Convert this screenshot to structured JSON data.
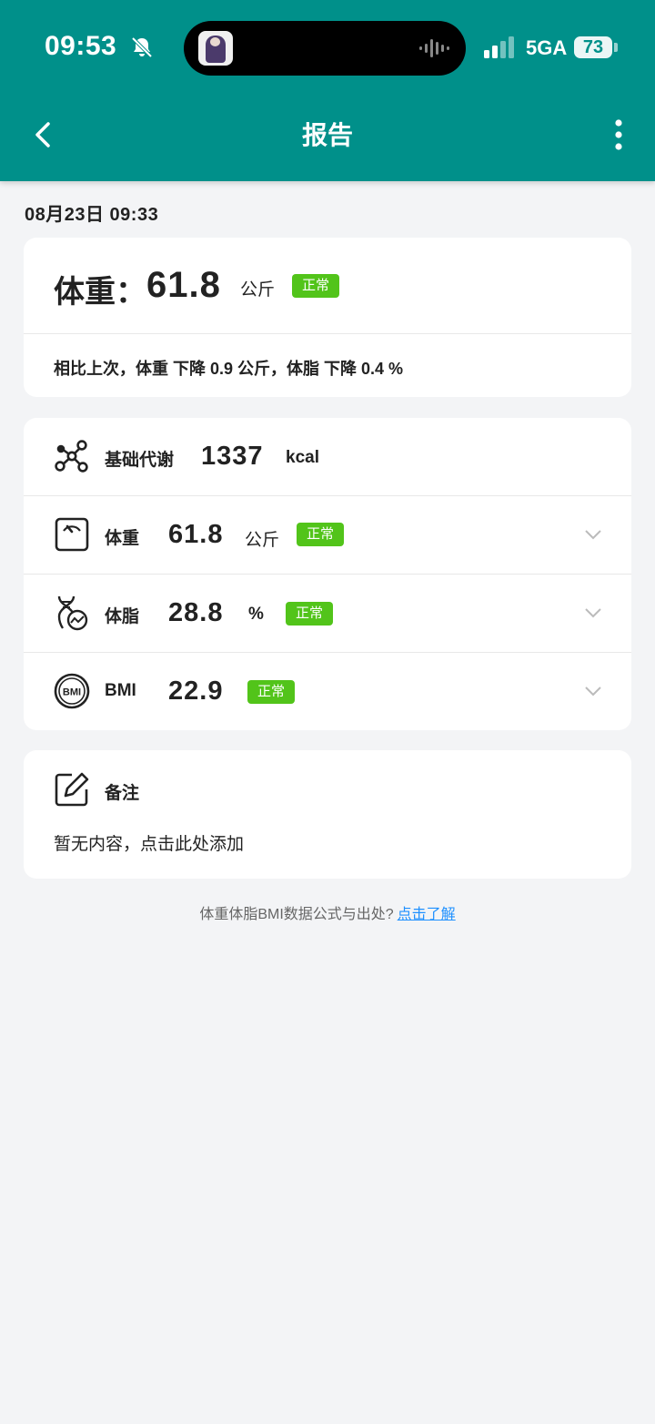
{
  "status_bar": {
    "time": "09:53",
    "network": "5GA",
    "battery": "73",
    "icons": [
      "bell-mute-icon",
      "waveform-icon",
      "signal-icon",
      "battery-icon"
    ]
  },
  "header": {
    "title": "报告",
    "back_icon": "chevron-left-icon",
    "more_icon": "more-vertical-icon"
  },
  "report": {
    "date": "08月23日 09:33",
    "summary": {
      "label": "体重：",
      "value": "61.8",
      "unit": "公斤",
      "status": "正常",
      "comparison": "相比上次，体重 下降 0.9 公斤，体脂 下降 0.4 %"
    },
    "metrics": {
      "bmr": {
        "icon": "molecule-icon",
        "label": "基础代谢",
        "value": "1337",
        "unit": "kcal"
      },
      "weight": {
        "icon": "scale-icon",
        "label": "体重",
        "value": "61.8",
        "unit": "公斤",
        "status": "正常"
      },
      "body_fat": {
        "icon": "dna-icon",
        "label": "体脂",
        "value": "28.8",
        "unit": "%",
        "status": "正常"
      },
      "bmi": {
        "icon": "bmi-icon",
        "label": "BMI",
        "value": "22.9",
        "status": "正常"
      }
    },
    "note": {
      "icon": "edit-icon",
      "title": "备注",
      "placeholder": "暂无内容，点击此处添加"
    },
    "footer": {
      "question": "体重体脂BMI数据公式与出处?",
      "link": "点击了解"
    }
  },
  "colors": {
    "header": "#00908a",
    "badge": "#52c41a",
    "background": "#f3f4f6",
    "link": "#1e90ff"
  }
}
